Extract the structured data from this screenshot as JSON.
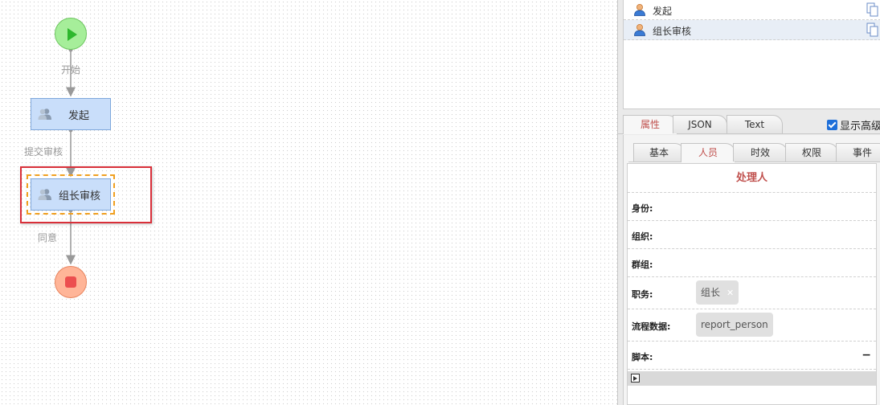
{
  "flow": {
    "start_label": "开始",
    "submit_label": "提交审核",
    "agree_label": "同意",
    "nodes": {
      "launch": "发起",
      "leader_review": "组长审核"
    }
  },
  "activities": [
    {
      "label": "发起",
      "active": false
    },
    {
      "label": "组长审核",
      "active": true
    }
  ],
  "top_tabs": {
    "properties": "属性",
    "json": "JSON",
    "text": "Text",
    "show_advanced": "显示高级"
  },
  "sub_tabs": {
    "basic": "基本",
    "people": "人员",
    "timing": "时效",
    "permission": "权限",
    "events": "事件"
  },
  "form": {
    "title": "处理人",
    "identity_label": "身份:",
    "org_label": "组织:",
    "group_label": "群组:",
    "duty_label": "职务:",
    "duty_value": "组长",
    "flowdata_label": "流程数据:",
    "flowdata_value": "report_person",
    "script_label": "脚本:",
    "collapse": "−"
  },
  "colors": {
    "selected_tab": "#c0504d",
    "start_node": "#a6ee9a",
    "end_node": "#ffb598",
    "task_node": "#c9defa",
    "highlight": "#d9303a"
  }
}
